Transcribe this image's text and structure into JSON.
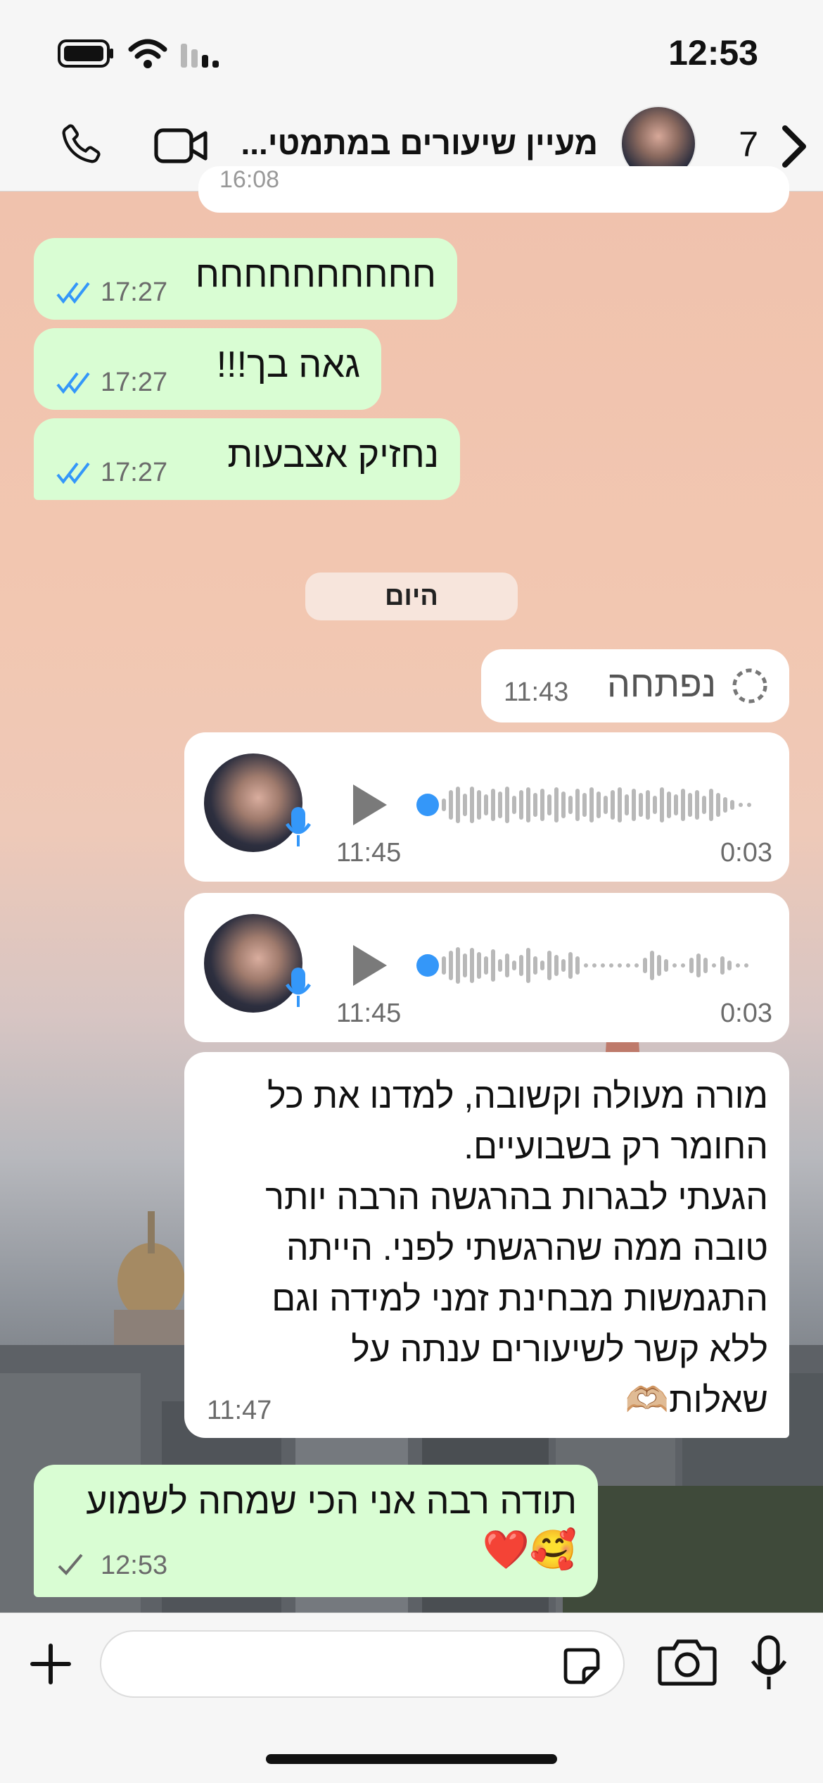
{
  "status_bar": {
    "time": "12:53"
  },
  "header": {
    "title": "מעיין שיעורים במתמטי...",
    "unread_count": "7"
  },
  "messages": {
    "m1": {
      "text": "חחחחחחחחחח",
      "time": "17:27"
    },
    "m2": {
      "text": "גאה בך!!!",
      "time": "17:27"
    },
    "m3": {
      "text": "נחזיק אצבעות",
      "time": "17:27"
    },
    "day_divider": "היום",
    "m4": {
      "text": "נפתחה",
      "time": "11:43"
    },
    "voice1": {
      "time": "11:45",
      "duration": "0:03"
    },
    "voice2": {
      "time": "11:45",
      "duration": "0:03"
    },
    "m5": {
      "lines": [
        "מורה מעולה וקשובה, למדנו את כל",
        "החומר רק בשבועיים.",
        "הגעתי לבגרות בהרגשה הרבה יותר",
        "טובה ממה שהרגשתי לפני. הייתה",
        "התגמשות מבחינת זמני למידה וגם",
        "ללא קשר לשיעורים ענתה על",
        "שאלות🫶🏼"
      ],
      "time": "11:47"
    },
    "m6": {
      "line1": "תודה רבה אני הכי שמחה לשמוע",
      "line2": "🥰❤️",
      "time": "12:53"
    },
    "partial_time": "16:08"
  },
  "icons": {
    "back": "chevron-left-icon",
    "call": "phone-icon",
    "video": "video-camera-icon",
    "attach": "plus-icon",
    "sticker": "sticker-icon",
    "camera": "camera-icon",
    "mic": "microphone-icon"
  },
  "colors": {
    "outgoing_bubble": "#d9fdd3",
    "incoming_bubble": "#ffffff",
    "read_ticks": "#3497f9",
    "voice_accent": "#3497f9"
  }
}
